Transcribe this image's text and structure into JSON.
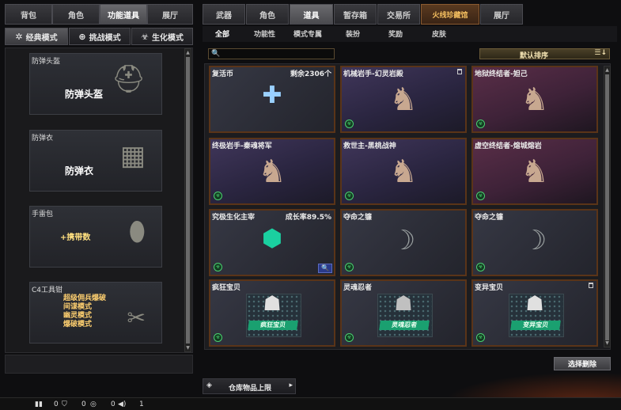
{
  "left_tabs": [
    "背包",
    "角色",
    "功能道具",
    "展厅"
  ],
  "left_active": 2,
  "modes": [
    {
      "label": "经典模式",
      "icon": "star-icon"
    },
    {
      "label": "挑战模式",
      "icon": "target-icon"
    },
    {
      "label": "生化模式",
      "icon": "biohazard-icon"
    }
  ],
  "equipment": [
    {
      "label": "防弹头盔",
      "big": "防弹头盔",
      "icon": "helmet-icon"
    },
    {
      "label": "防弹衣",
      "big": "防弹衣",
      "icon": "vest-icon"
    },
    {
      "label": "手雷包",
      "big": "+携带数",
      "icon": "grenade-icon"
    },
    {
      "label": "C4工具钳",
      "lines": [
        "超级佣兵爆破",
        "间谍模式",
        "幽灵模式",
        "爆破模式"
      ],
      "icon": "pliers-icon"
    }
  ],
  "right_tabs": [
    "武器",
    "角色",
    "道具",
    "暂存箱",
    "交易所",
    "火线珍藏馆",
    "展厅"
  ],
  "right_active": 2,
  "sub_tabs": [
    "全部",
    "功能性",
    "模式专属",
    "装扮",
    "奖励",
    "皮肤"
  ],
  "sub_active": 0,
  "sort": {
    "label": "默认排序"
  },
  "cards": [
    {
      "name": "复活币",
      "right": "剩余2306个",
      "style": "plain",
      "icon": "revive-coin-icon"
    },
    {
      "name": "机械岩手-幻灵岩殿",
      "style": "purple",
      "icon": "character-icon",
      "trash": true
    },
    {
      "name": "地狱终结者-妲己",
      "style": "red",
      "icon": "character-icon"
    },
    {
      "name": "终极岩手-秦魂将军",
      "style": "purple",
      "icon": "character-icon"
    },
    {
      "name": "救世主-黑桃战神",
      "style": "purple",
      "icon": "character-icon"
    },
    {
      "name": "虚空终结者-熔城熔岩",
      "style": "red",
      "icon": "character-icon"
    },
    {
      "name": "究极生化主宰",
      "right": "成长率89.5%",
      "style": "plain",
      "icon": "zombie-mark-icon",
      "search": true
    },
    {
      "name": "夺命之镰",
      "style": "plain",
      "icon": "scythe-icon"
    },
    {
      "name": "夺命之镰",
      "style": "plain",
      "icon": "scythe-icon"
    },
    {
      "name": "疯狂宝贝",
      "style": "plain",
      "icon": "ghost-girl-icon",
      "ribbon": "疯狂宝贝"
    },
    {
      "name": "灵魂忍者",
      "style": "plain",
      "icon": "ninja-icon",
      "ribbon": "灵魂忍者"
    },
    {
      "name": "变异宝贝",
      "style": "plain",
      "icon": "ghost-girl-icon",
      "ribbon": "变异宝贝",
      "trash": true
    }
  ],
  "select_delete": "选择删除",
  "stock_label": "仓库物品上限",
  "bottom": {
    "v1": "0",
    "v2": "0",
    "v3": "0",
    "v4": "1"
  }
}
